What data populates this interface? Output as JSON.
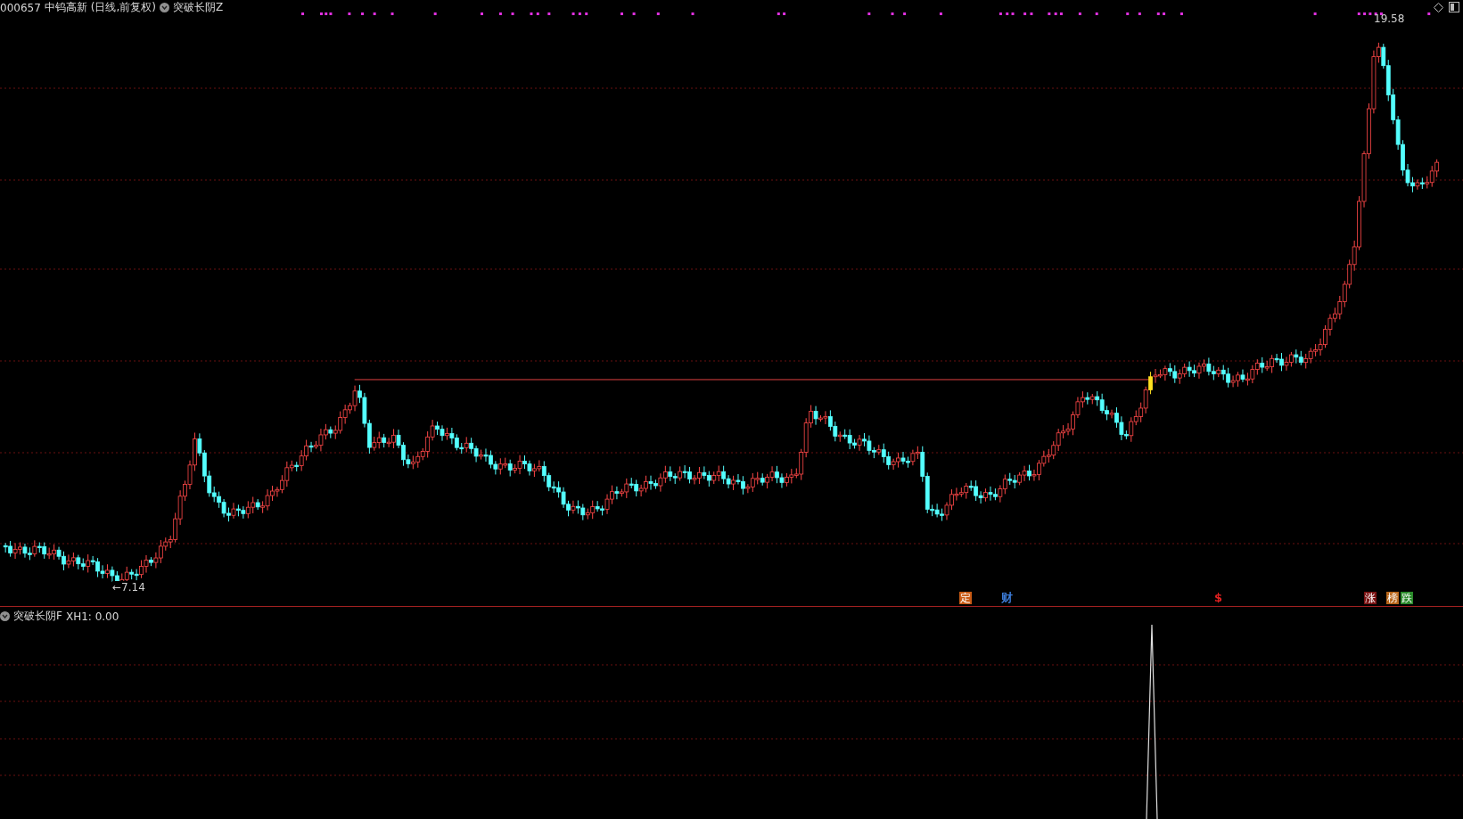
{
  "header": {
    "code": "000657",
    "name": "中钨高新",
    "period": "(日线,前复权)",
    "indicator": "突破长阴Z"
  },
  "price_labels": [
    {
      "kind": "high",
      "text": "19.58"
    },
    {
      "kind": "low",
      "text": "←7.14"
    }
  ],
  "markers": [
    {
      "text": "定",
      "kind": "filled",
      "color": "#c85a14"
    },
    {
      "text": "财",
      "kind": "text",
      "color": "#3c7cd8"
    },
    {
      "text": "$",
      "kind": "text",
      "color": "#e02020"
    },
    {
      "text": "涨",
      "kind": "filled",
      "color": "#7a1414"
    },
    {
      "text": "榜",
      "kind": "filled",
      "color": "#b8661a"
    },
    {
      "text": "跌",
      "kind": "filled",
      "color": "#2a8a2a"
    }
  ],
  "lower": {
    "indicator": "突破长阴F",
    "readout": "XH1: 0.00"
  }
}
